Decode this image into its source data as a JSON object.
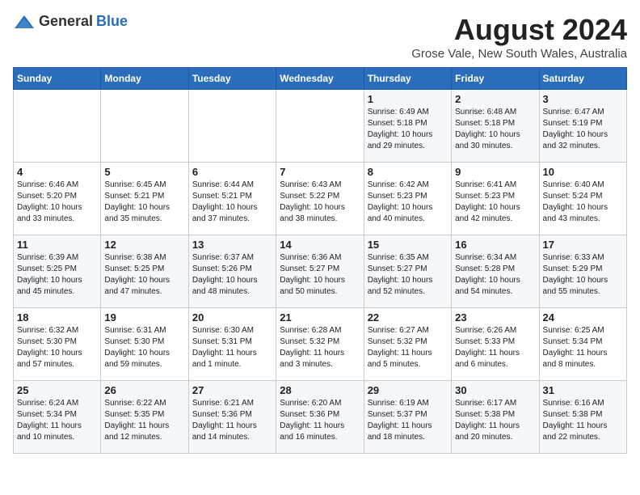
{
  "header": {
    "logo_general": "General",
    "logo_blue": "Blue",
    "title": "August 2024",
    "subtitle": "Grose Vale, New South Wales, Australia"
  },
  "weekdays": [
    "Sunday",
    "Monday",
    "Tuesday",
    "Wednesday",
    "Thursday",
    "Friday",
    "Saturday"
  ],
  "weeks": [
    [
      {
        "day": "",
        "info": ""
      },
      {
        "day": "",
        "info": ""
      },
      {
        "day": "",
        "info": ""
      },
      {
        "day": "",
        "info": ""
      },
      {
        "day": "1",
        "info": "Sunrise: 6:49 AM\nSunset: 5:18 PM\nDaylight: 10 hours\nand 29 minutes."
      },
      {
        "day": "2",
        "info": "Sunrise: 6:48 AM\nSunset: 5:18 PM\nDaylight: 10 hours\nand 30 minutes."
      },
      {
        "day": "3",
        "info": "Sunrise: 6:47 AM\nSunset: 5:19 PM\nDaylight: 10 hours\nand 32 minutes."
      }
    ],
    [
      {
        "day": "4",
        "info": "Sunrise: 6:46 AM\nSunset: 5:20 PM\nDaylight: 10 hours\nand 33 minutes."
      },
      {
        "day": "5",
        "info": "Sunrise: 6:45 AM\nSunset: 5:21 PM\nDaylight: 10 hours\nand 35 minutes."
      },
      {
        "day": "6",
        "info": "Sunrise: 6:44 AM\nSunset: 5:21 PM\nDaylight: 10 hours\nand 37 minutes."
      },
      {
        "day": "7",
        "info": "Sunrise: 6:43 AM\nSunset: 5:22 PM\nDaylight: 10 hours\nand 38 minutes."
      },
      {
        "day": "8",
        "info": "Sunrise: 6:42 AM\nSunset: 5:23 PM\nDaylight: 10 hours\nand 40 minutes."
      },
      {
        "day": "9",
        "info": "Sunrise: 6:41 AM\nSunset: 5:23 PM\nDaylight: 10 hours\nand 42 minutes."
      },
      {
        "day": "10",
        "info": "Sunrise: 6:40 AM\nSunset: 5:24 PM\nDaylight: 10 hours\nand 43 minutes."
      }
    ],
    [
      {
        "day": "11",
        "info": "Sunrise: 6:39 AM\nSunset: 5:25 PM\nDaylight: 10 hours\nand 45 minutes."
      },
      {
        "day": "12",
        "info": "Sunrise: 6:38 AM\nSunset: 5:25 PM\nDaylight: 10 hours\nand 47 minutes."
      },
      {
        "day": "13",
        "info": "Sunrise: 6:37 AM\nSunset: 5:26 PM\nDaylight: 10 hours\nand 48 minutes."
      },
      {
        "day": "14",
        "info": "Sunrise: 6:36 AM\nSunset: 5:27 PM\nDaylight: 10 hours\nand 50 minutes."
      },
      {
        "day": "15",
        "info": "Sunrise: 6:35 AM\nSunset: 5:27 PM\nDaylight: 10 hours\nand 52 minutes."
      },
      {
        "day": "16",
        "info": "Sunrise: 6:34 AM\nSunset: 5:28 PM\nDaylight: 10 hours\nand 54 minutes."
      },
      {
        "day": "17",
        "info": "Sunrise: 6:33 AM\nSunset: 5:29 PM\nDaylight: 10 hours\nand 55 minutes."
      }
    ],
    [
      {
        "day": "18",
        "info": "Sunrise: 6:32 AM\nSunset: 5:30 PM\nDaylight: 10 hours\nand 57 minutes."
      },
      {
        "day": "19",
        "info": "Sunrise: 6:31 AM\nSunset: 5:30 PM\nDaylight: 10 hours\nand 59 minutes."
      },
      {
        "day": "20",
        "info": "Sunrise: 6:30 AM\nSunset: 5:31 PM\nDaylight: 11 hours\nand 1 minute."
      },
      {
        "day": "21",
        "info": "Sunrise: 6:28 AM\nSunset: 5:32 PM\nDaylight: 11 hours\nand 3 minutes."
      },
      {
        "day": "22",
        "info": "Sunrise: 6:27 AM\nSunset: 5:32 PM\nDaylight: 11 hours\nand 5 minutes."
      },
      {
        "day": "23",
        "info": "Sunrise: 6:26 AM\nSunset: 5:33 PM\nDaylight: 11 hours\nand 6 minutes."
      },
      {
        "day": "24",
        "info": "Sunrise: 6:25 AM\nSunset: 5:34 PM\nDaylight: 11 hours\nand 8 minutes."
      }
    ],
    [
      {
        "day": "25",
        "info": "Sunrise: 6:24 AM\nSunset: 5:34 PM\nDaylight: 11 hours\nand 10 minutes."
      },
      {
        "day": "26",
        "info": "Sunrise: 6:22 AM\nSunset: 5:35 PM\nDaylight: 11 hours\nand 12 minutes."
      },
      {
        "day": "27",
        "info": "Sunrise: 6:21 AM\nSunset: 5:36 PM\nDaylight: 11 hours\nand 14 minutes."
      },
      {
        "day": "28",
        "info": "Sunrise: 6:20 AM\nSunset: 5:36 PM\nDaylight: 11 hours\nand 16 minutes."
      },
      {
        "day": "29",
        "info": "Sunrise: 6:19 AM\nSunset: 5:37 PM\nDaylight: 11 hours\nand 18 minutes."
      },
      {
        "day": "30",
        "info": "Sunrise: 6:17 AM\nSunset: 5:38 PM\nDaylight: 11 hours\nand 20 minutes."
      },
      {
        "day": "31",
        "info": "Sunrise: 6:16 AM\nSunset: 5:38 PM\nDaylight: 11 hours\nand 22 minutes."
      }
    ]
  ]
}
